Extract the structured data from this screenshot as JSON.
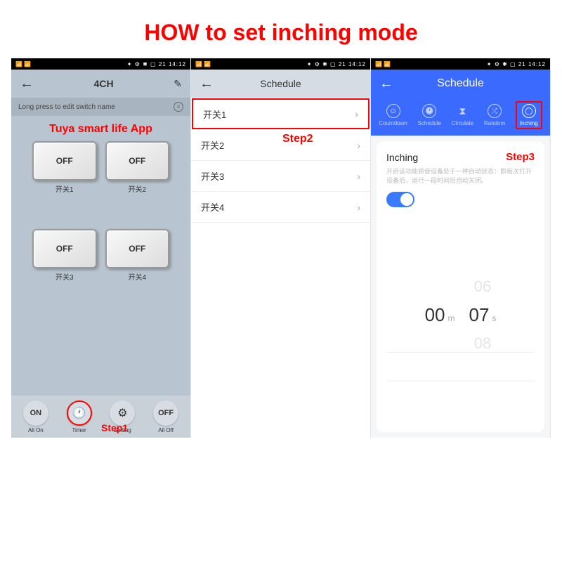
{
  "title": "HOW to set inching mode",
  "status_time": "14:12",
  "status_icons": "✦ ⚙ ✱ ▢ 21",
  "phone1": {
    "header_title": "4CH",
    "hint": "Long press to edit switch name",
    "app_label": "Tuya smart life  App",
    "switches": [
      {
        "state": "OFF",
        "label": "开关1"
      },
      {
        "state": "OFF",
        "label": "开关2"
      },
      {
        "state": "OFF",
        "label": "开关3"
      },
      {
        "state": "OFF",
        "label": "开关4"
      }
    ],
    "bottom": {
      "all_on": "ON",
      "all_on_label": "All On",
      "timer_label": "Timer",
      "setting_label": "Setting",
      "all_off": "OFF",
      "all_off_label": "All Off"
    },
    "step_label": "Step1"
  },
  "phone2": {
    "header_title": "Schedule",
    "items": [
      "开关1",
      "开关2",
      "开关3",
      "开关4"
    ],
    "step_label": "Step2"
  },
  "phone3": {
    "header_title": "Schedule",
    "tabs": [
      {
        "label": "Countdown"
      },
      {
        "label": "Schedule"
      },
      {
        "label": "Circulate"
      },
      {
        "label": "Random"
      },
      {
        "label": "Inching"
      }
    ],
    "card_title": "Inching",
    "step_label": "Step3",
    "desc": "开启该功能将使设备处于一种自动状态：即每次打开设备后，运行一段时间后自动关闭。",
    "picker": {
      "min_above": "",
      "min": "00",
      "min_unit": "m",
      "min_below": "",
      "sec_above": "06",
      "sec": "07",
      "sec_unit": "s",
      "sec_below": "08"
    }
  }
}
